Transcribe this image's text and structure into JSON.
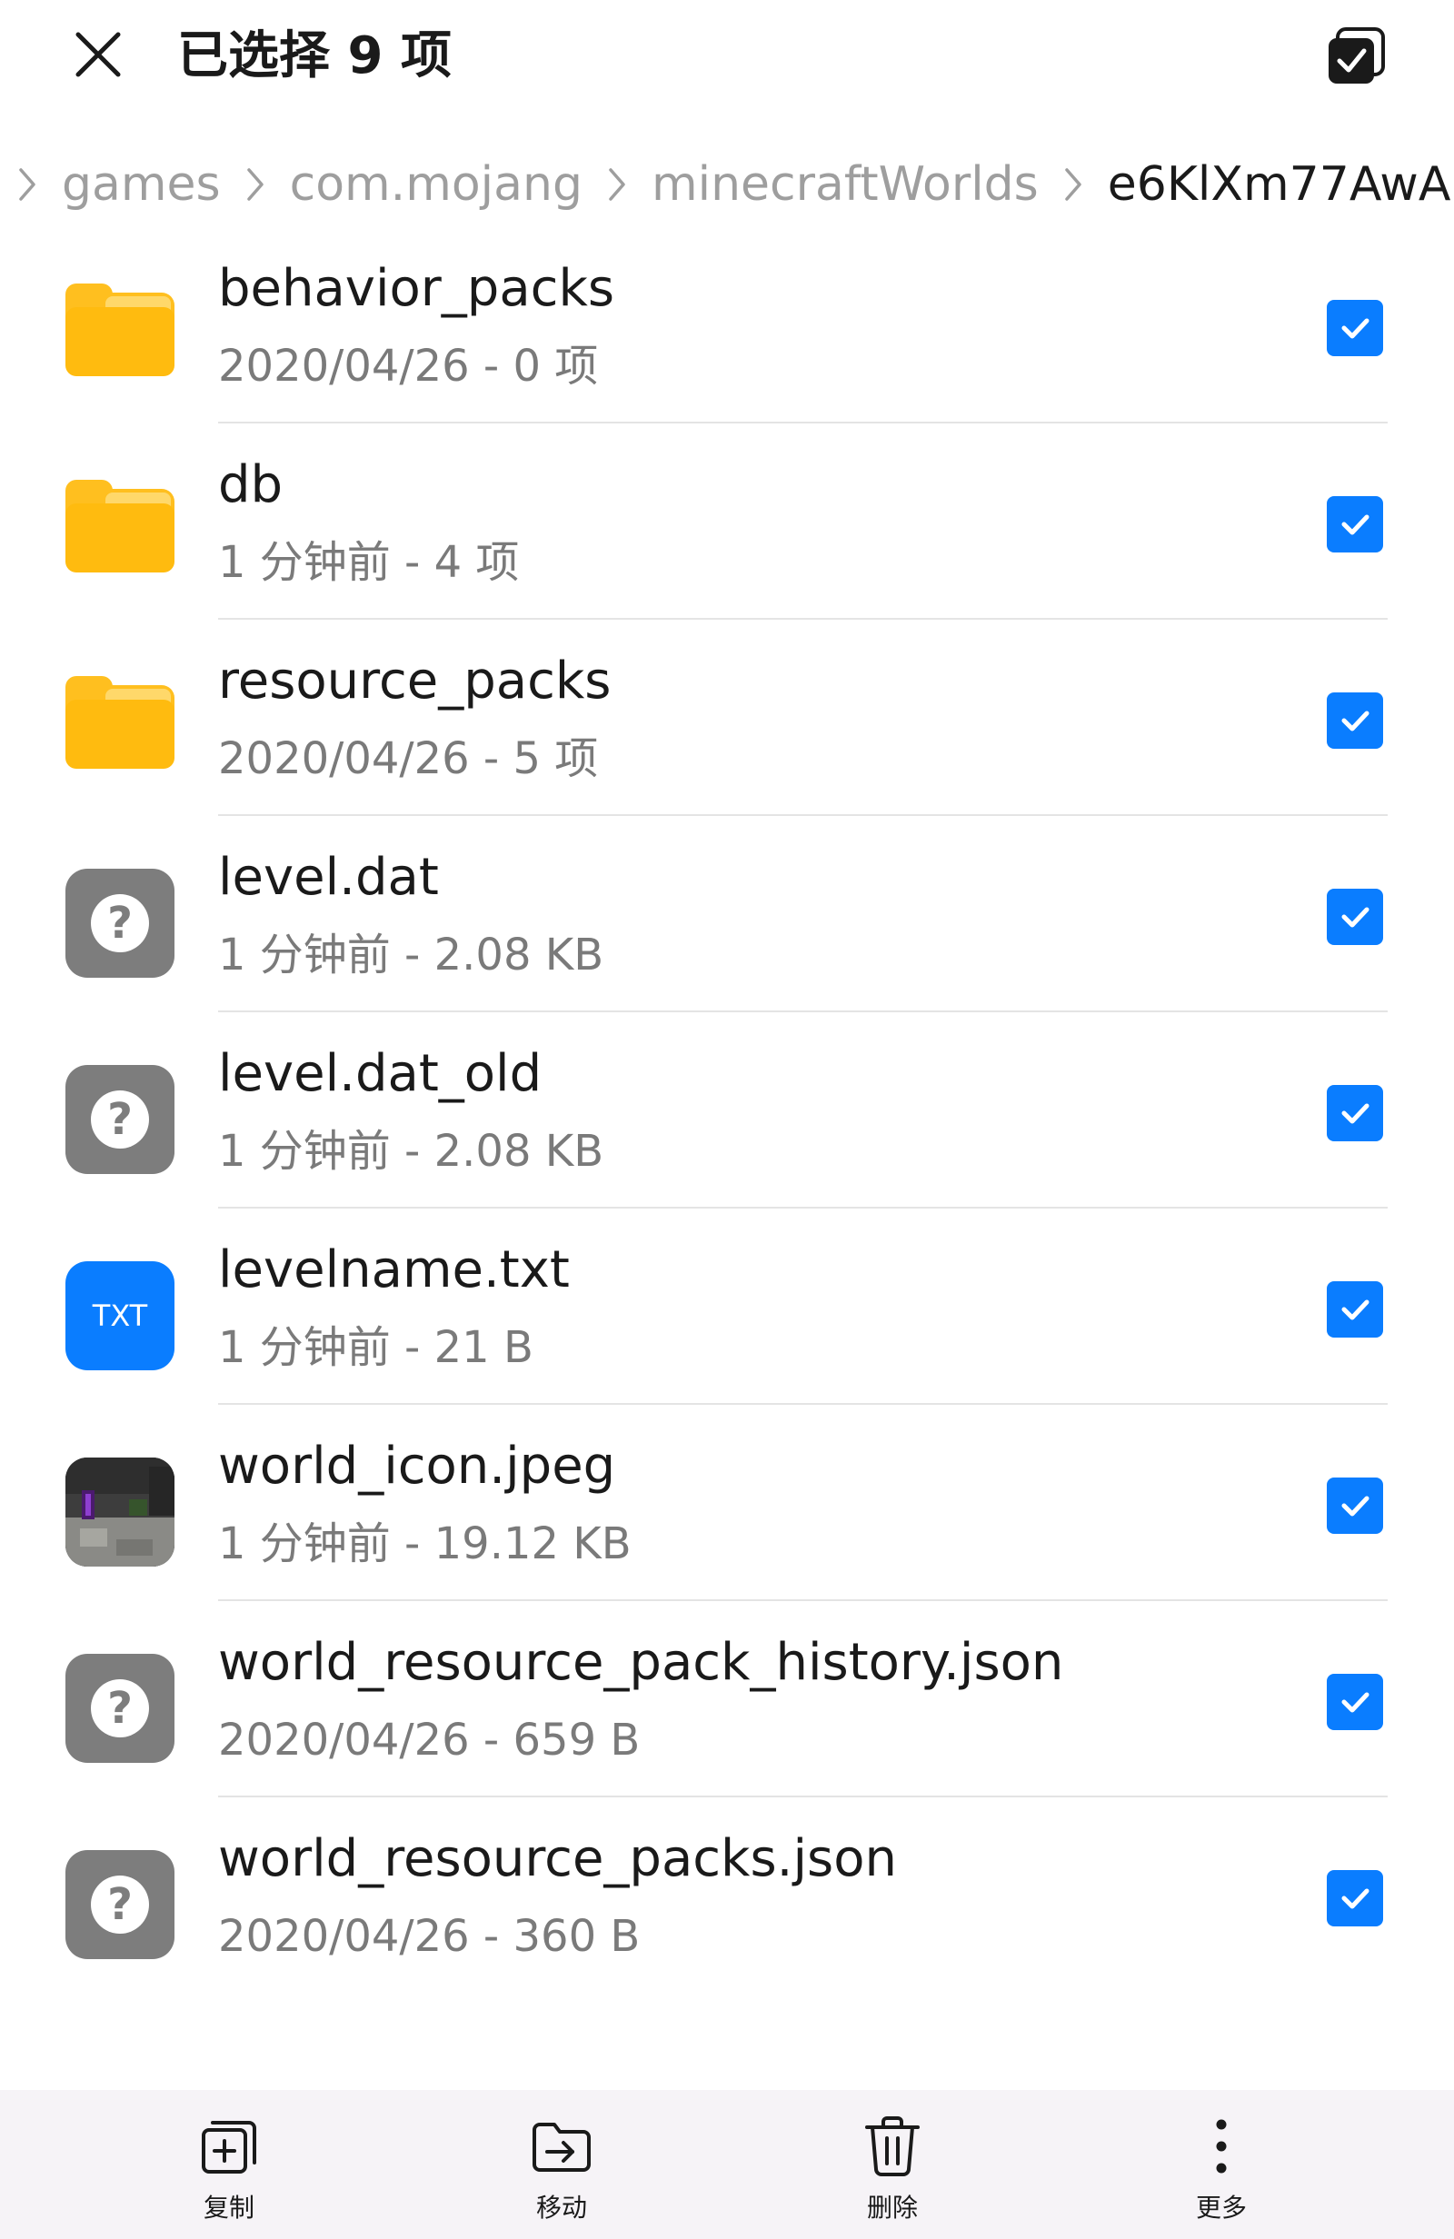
{
  "header": {
    "title": "已选择 9 项",
    "close_icon": "close-icon",
    "select_all_icon": "select-all-icon"
  },
  "breadcrumb": {
    "items": [
      "games",
      "com.mojang",
      "minecraftWorlds"
    ],
    "current": "e6KlXm77AwA="
  },
  "files": [
    {
      "name": "behavior_packs",
      "meta": "2020/04/26 - 0 项",
      "type": "folder",
      "checked": true
    },
    {
      "name": "db",
      "meta": "1 分钟前 - 4 项",
      "type": "folder",
      "checked": true
    },
    {
      "name": "resource_packs",
      "meta": "2020/04/26 - 5 项",
      "type": "folder",
      "checked": true
    },
    {
      "name": "level.dat",
      "meta": "1 分钟前 - 2.08 KB",
      "type": "unknown",
      "checked": true
    },
    {
      "name": "level.dat_old",
      "meta": "1 分钟前 - 2.08 KB",
      "type": "unknown",
      "checked": true
    },
    {
      "name": "levelname.txt",
      "meta": "1 分钟前 - 21 B",
      "type": "txt",
      "icon_text": "TXT",
      "checked": true
    },
    {
      "name": "world_icon.jpeg",
      "meta": "1 分钟前 - 19.12 KB",
      "type": "image",
      "checked": true
    },
    {
      "name": "world_resource_pack_history.json",
      "meta": "2020/04/26 - 659 B",
      "type": "unknown",
      "checked": true
    },
    {
      "name": "world_resource_packs.json",
      "meta": "2020/04/26 - 360 B",
      "type": "unknown",
      "checked": true
    }
  ],
  "unknown_glyph": "?",
  "toolbar": {
    "copy_label": "复制",
    "move_label": "移动",
    "delete_label": "删除",
    "more_label": "更多"
  },
  "colors": {
    "accent": "#0a7dff",
    "folder": "#ffbb0f",
    "unknown_icon": "#7d7d7d",
    "toolbar_bg": "#f6f3f7"
  }
}
